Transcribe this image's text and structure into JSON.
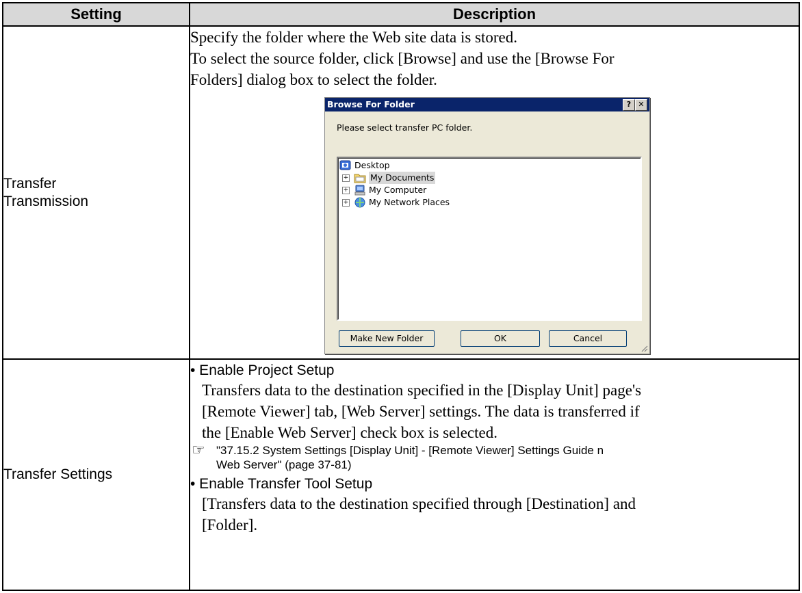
{
  "table": {
    "headers": {
      "setting": "Setting",
      "description": "Description"
    },
    "row1": {
      "setting_lines": [
        "Transfer",
        "Transmission"
      ],
      "desc_lines": [
        "Specify the folder where the Web site data is stored.",
        "To select the source folder, click [Browse] and use the [Browse For",
        "Folders] dialog box to select the folder."
      ]
    },
    "row2": {
      "setting": "Transfer Settings",
      "bullet1": "• Enable Project Setup",
      "bullet1_text": [
        "Transfers data to the destination specified in the [Display Unit] page's",
        "[Remote Viewer] tab, [Web Server] settings. The data is transferred if",
        "the [Enable Web Server] check box is selected."
      ],
      "ref_icon": "pointing-hand-icon",
      "ref_lines": [
        "\"37.15.2 System Settings [Display Unit] - [Remote Viewer] Settings Guide n",
        "Web Server\" (page 37-81)"
      ],
      "bullet2": "• Enable Transfer Tool Setup",
      "bullet2_text": [
        "[Transfers data to the destination specified through [Destination] and",
        "[Folder]."
      ]
    }
  },
  "dialog": {
    "title": "Browse For Folder",
    "help_label": "?",
    "close_label": "✕",
    "prompt": "Please select transfer PC folder.",
    "tree": [
      {
        "label": "Desktop",
        "icon": "desktop-icon"
      },
      {
        "label": "My Documents",
        "icon": "folder-icon",
        "selected": true
      },
      {
        "label": "My Computer",
        "icon": "computer-icon"
      },
      {
        "label": "My Network Places",
        "icon": "network-icon"
      }
    ],
    "expand_symbol": "+",
    "buttons": {
      "new_folder": "Make New Folder",
      "ok": "OK",
      "cancel": "Cancel"
    }
  }
}
